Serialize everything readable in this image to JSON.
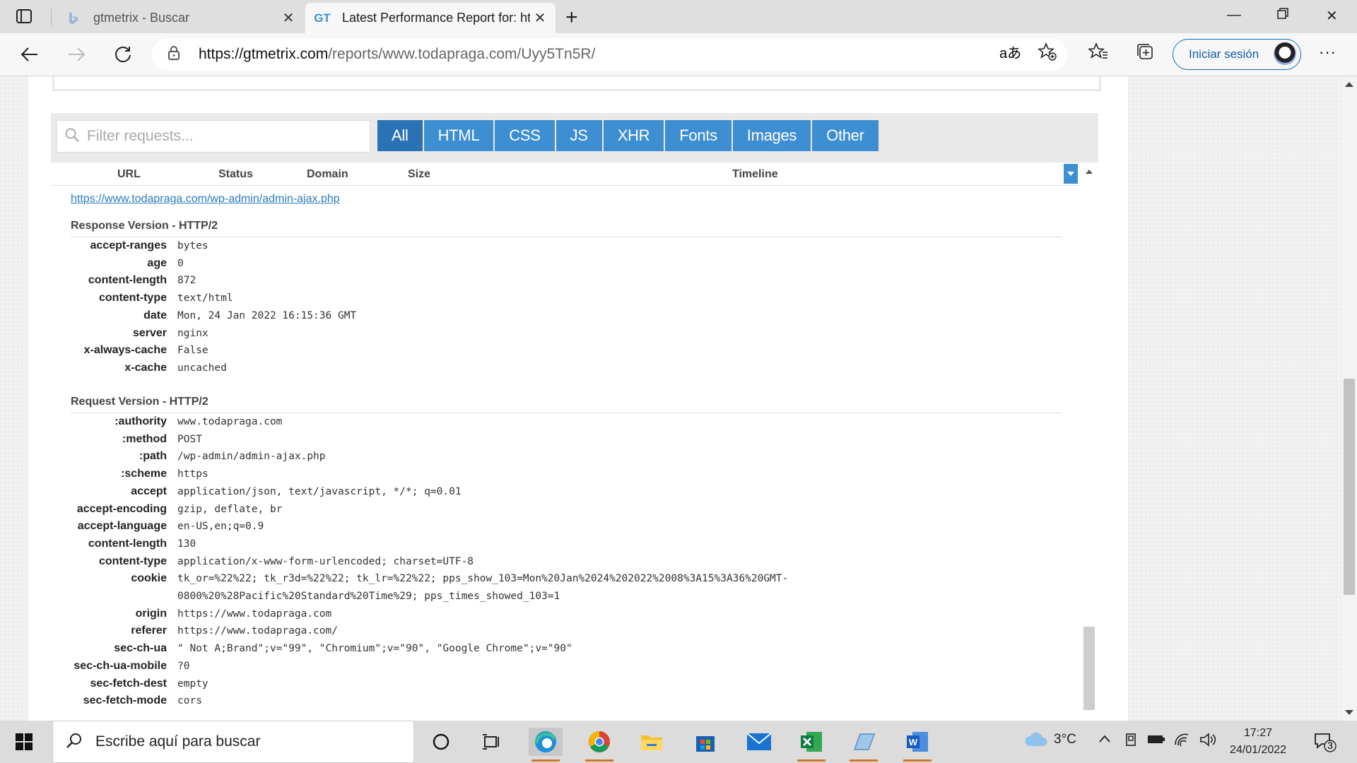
{
  "browser": {
    "tabs": [
      {
        "title": "gtmetrix - Buscar",
        "favicon": "bing-icon",
        "active": false
      },
      {
        "title": "Latest Performance Report for: ht",
        "favicon": "GT",
        "active": true
      }
    ],
    "url_host": "https://gtmetrix.com",
    "url_path": "/reports/www.todapraga.com/Uyy5Tn5R/",
    "signin_label": "Iniciar sesión"
  },
  "waterfall": {
    "filter_placeholder": "Filter requests...",
    "filter_tabs": [
      "All",
      "HTML",
      "CSS",
      "JS",
      "XHR",
      "Fonts",
      "Images",
      "Other"
    ],
    "active_filter": "All",
    "columns": [
      "URL",
      "Status",
      "Domain",
      "Size",
      "Timeline"
    ],
    "request_url": "https://www.todapraga.com/wp-admin/admin-ajax.php",
    "response_title": "Response Version - HTTP/2",
    "response_headers": [
      {
        "k": "accept-ranges",
        "v": "bytes"
      },
      {
        "k": "age",
        "v": "0"
      },
      {
        "k": "content-length",
        "v": "872"
      },
      {
        "k": "content-type",
        "v": "text/html"
      },
      {
        "k": "date",
        "v": "Mon, 24 Jan 2022 16:15:36 GMT"
      },
      {
        "k": "server",
        "v": "nginx"
      },
      {
        "k": "x-always-cache",
        "v": "False"
      },
      {
        "k": "x-cache",
        "v": "uncached"
      }
    ],
    "request_title": "Request Version - HTTP/2",
    "request_headers": [
      {
        "k": ":authority",
        "v": "www.todapraga.com"
      },
      {
        "k": ":method",
        "v": "POST"
      },
      {
        "k": ":path",
        "v": "/wp-admin/admin-ajax.php"
      },
      {
        "k": ":scheme",
        "v": "https"
      },
      {
        "k": "accept",
        "v": "application/json, text/javascript, */*; q=0.01"
      },
      {
        "k": "accept-encoding",
        "v": "gzip, deflate, br"
      },
      {
        "k": "accept-language",
        "v": "en-US,en;q=0.9"
      },
      {
        "k": "content-length",
        "v": "130"
      },
      {
        "k": "content-type",
        "v": "application/x-www-form-urlencoded; charset=UTF-8"
      },
      {
        "k": "cookie",
        "v": "tk_or=%22%22; tk_r3d=%22%22; tk_lr=%22%22; pps_show_103=Mon%20Jan%2024%202022%2008%3A15%3A36%20GMT-",
        "v2": "0800%20%28Pacific%20Standard%20Time%29; pps_times_showed_103=1"
      },
      {
        "k": "origin",
        "v": "https://www.todapraga.com"
      },
      {
        "k": "referer",
        "v": "https://www.todapraga.com/"
      },
      {
        "k": "sec-ch-ua",
        "v": "\" Not A;Brand\";v=\"99\", \"Chromium\";v=\"90\", \"Google Chrome\";v=\"90\""
      },
      {
        "k": "sec-ch-ua-mobile",
        "v": "?0"
      },
      {
        "k": "sec-fetch-dest",
        "v": "empty"
      },
      {
        "k": "sec-fetch-mode",
        "v": "cors"
      }
    ]
  },
  "taskbar": {
    "search_text": "Escribe aquí para buscar",
    "temperature": "3°C",
    "time": "17:27",
    "date": "24/01/2022",
    "notification_count": "3"
  },
  "colors": {
    "accent": "#3e8fd1",
    "accent_active": "#2b72b5",
    "link": "#2a7bbf"
  }
}
